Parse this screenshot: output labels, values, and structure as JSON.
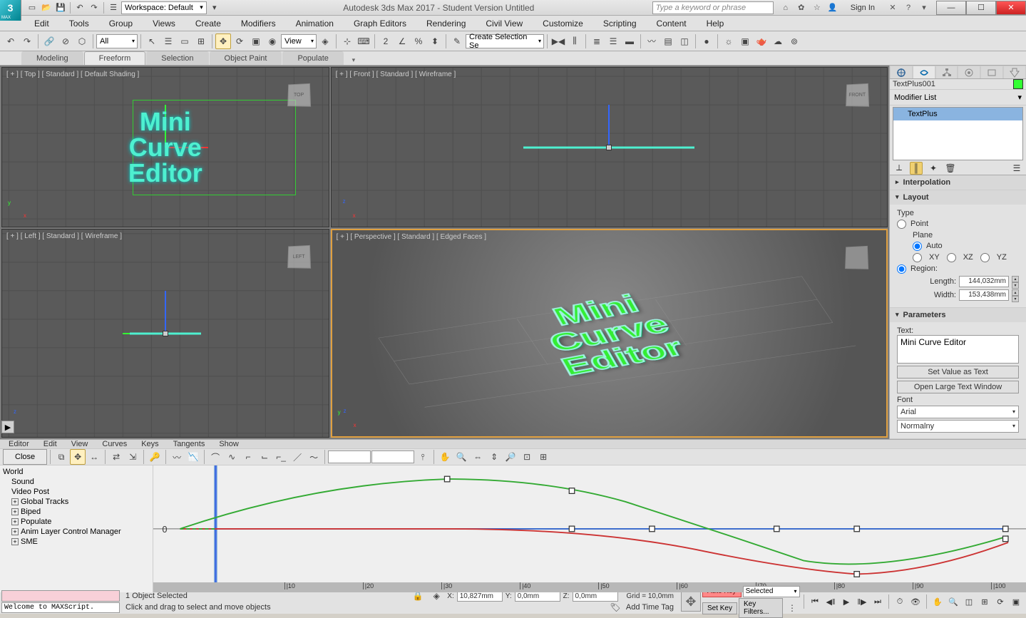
{
  "titlebar": {
    "app_title": "Autodesk 3ds Max 2017 - Student Version    Untitled",
    "workspace_label": "Workspace: Default",
    "search_placeholder": "Type a keyword or phrase",
    "signin": "Sign In"
  },
  "menu": {
    "items": [
      "Edit",
      "Tools",
      "Group",
      "Views",
      "Create",
      "Modifiers",
      "Animation",
      "Graph Editors",
      "Rendering",
      "Civil View",
      "Customize",
      "Scripting",
      "Content",
      "Help"
    ]
  },
  "maintoolbar": {
    "filter_all": "All",
    "view_sel": "View",
    "named_sel": "Create Selection Se"
  },
  "ribbon": {
    "tabs": [
      "Modeling",
      "Freeform",
      "Selection",
      "Object Paint",
      "Populate"
    ]
  },
  "viewports": {
    "top": "[ + ] [ Top ] [ Standard ] [ Default Shading ]",
    "front": "[ + ] [ Front ] [ Standard ] [ Wireframe ]",
    "left": "[ + ] [ Left ] [ Standard ] [ Wireframe ]",
    "persp": "[ + ] [ Perspective ] [ Standard ] [ Edged Faces ]",
    "cubes": {
      "top": "TOP",
      "front": "FRONT",
      "left": "LEFT",
      "persp": ""
    },
    "text_lines": [
      "Mini",
      "Curve",
      "Editor"
    ]
  },
  "cmdpanel": {
    "object_name": "TextPlus001",
    "modifier_list_label": "Modifier List",
    "modstack_item": "TextPlus",
    "rollouts": {
      "interpolation": "Interpolation",
      "layout": "Layout",
      "parameters": "Parameters"
    },
    "layout": {
      "type_label": "Type",
      "point": "Point",
      "plane": "Plane",
      "auto": "Auto",
      "xy": "XY",
      "xz": "XZ",
      "yz": "YZ",
      "region": "Region:",
      "length_label": "Length:",
      "length_val": "144,032mm",
      "width_label": "Width:",
      "width_val": "153,438mm"
    },
    "parameters": {
      "text_label": "Text:",
      "text_value": "Mini Curve Editor",
      "set_value": "Set Value as Text",
      "open_large": "Open Large Text Window",
      "font_label": "Font",
      "font_val": "Arial",
      "style_val": "Normalny"
    }
  },
  "curve_editor": {
    "menu": [
      "Editor",
      "Edit",
      "View",
      "Curves",
      "Keys",
      "Tangents",
      "Show"
    ],
    "close": "Close",
    "tree": [
      "World",
      "Sound",
      "Video Post",
      "Global Tracks",
      "Biped",
      "Populate",
      "Anim Layer Control Manager",
      "SME"
    ],
    "zero": "0",
    "ticks": [
      "|10",
      "|20",
      "|30",
      "|40",
      "|50",
      "|60",
      "|70",
      "|80",
      "|90",
      "|100"
    ]
  },
  "status": {
    "welcome": "Welcome to MAXScript.",
    "selected": "1 Object Selected",
    "hint": "Click and drag to select and move objects",
    "x_lbl": "X:",
    "x_val": "10,827mm",
    "y_lbl": "Y:",
    "y_val": "0,0mm",
    "z_lbl": "Z:",
    "z_val": "0,0mm",
    "grid": "Grid = 10,0mm",
    "addtag": "Add Time Tag",
    "autokey": "Auto Key",
    "setkey": "Set Key",
    "keymode": "Selected",
    "keyfilters": "Key Filters..."
  },
  "chart_data": {
    "type": "line",
    "x": [
      0,
      10,
      20,
      30,
      40,
      50,
      60,
      70,
      80,
      90,
      100
    ],
    "xlabel": "",
    "ylabel": "",
    "ylim": [
      -50,
      50
    ],
    "series": [
      {
        "name": "green",
        "color": "#3a3",
        "values": [
          0,
          18,
          32,
          44,
          49,
          48,
          38,
          18,
          -6,
          -20,
          -9
        ]
      },
      {
        "name": "red",
        "color": "#c33",
        "values": [
          0,
          0,
          0,
          0,
          0,
          -3,
          -10,
          -22,
          -30,
          -22,
          -8
        ]
      },
      {
        "name": "blue",
        "color": "#36c",
        "values": [
          0,
          0,
          0,
          0,
          0,
          0,
          0,
          0,
          0,
          0,
          0
        ]
      }
    ],
    "keyframes_x": [
      30,
      50,
      60,
      70,
      80,
      100
    ]
  }
}
